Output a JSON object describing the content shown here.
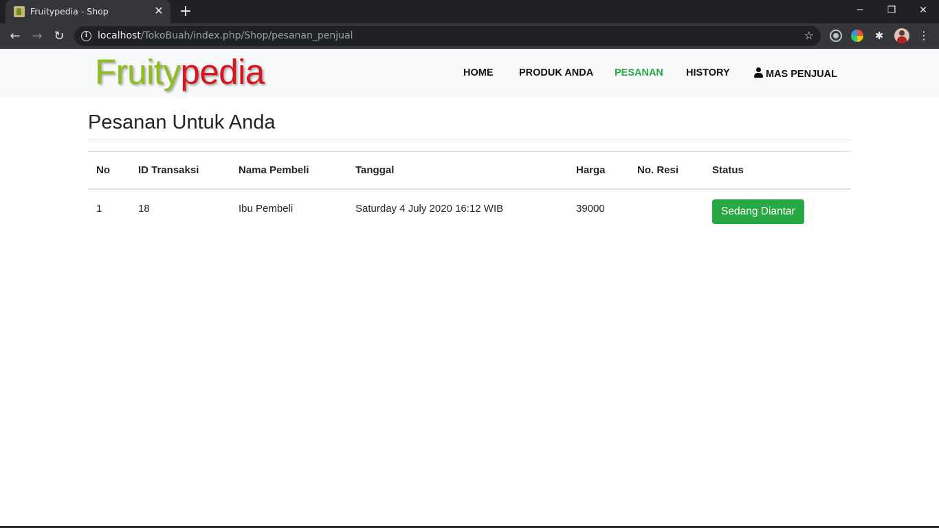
{
  "browser": {
    "tab_title": "Fruitypedia - Shop",
    "tab_close": "✕",
    "new_tab": "+",
    "url_host": "localhost",
    "url_path": "/TokoBuah/index.php/Shop/pesanan_penjual",
    "window_controls": {
      "minimize": "─",
      "restore": "❐",
      "close": "✕"
    },
    "icons": {
      "back": "arrow-left",
      "forward": "arrow-right",
      "reload": "reload",
      "info": "info",
      "bookmark": "star",
      "extensions": "puzzle",
      "menu": "three-dots"
    }
  },
  "navbar": {
    "brand_part1": "Fruity",
    "brand_part2": "pedia",
    "items": [
      {
        "label": "HOME",
        "active": false
      },
      {
        "label": "PRODUK ANDA",
        "active": false
      },
      {
        "label": "PESANAN",
        "active": true
      },
      {
        "label": "HISTORY",
        "active": false
      },
      {
        "label": "MAS PENJUAL",
        "active": false
      }
    ],
    "active_color": "#28a745"
  },
  "main": {
    "title": "Pesanan Untuk Anda",
    "table": {
      "headers": [
        "No",
        "ID Transaksi",
        "Nama Pembeli",
        "Tanggal",
        "Harga",
        "No. Resi",
        "Status"
      ],
      "rows": [
        {
          "no": "1",
          "id_transaksi": "18",
          "nama_pembeli": "Ibu Pembeli",
          "tanggal": "Saturday 4 July 2020 16:12 WIB",
          "harga": "39000",
          "no_resi": "",
          "status": "Sedang Diantar"
        }
      ]
    },
    "status_color": "#28a745"
  }
}
